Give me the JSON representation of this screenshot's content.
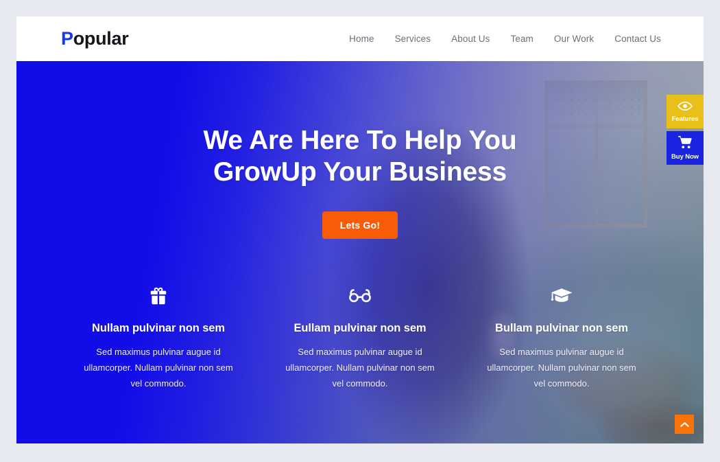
{
  "brand": {
    "accent_letter": "P",
    "rest": "opular",
    "accent_color": "#1439e8"
  },
  "nav": {
    "items": [
      {
        "label": "Home"
      },
      {
        "label": "Services"
      },
      {
        "label": "About Us"
      },
      {
        "label": "Team"
      },
      {
        "label": "Our Work"
      },
      {
        "label": "Contact Us"
      }
    ]
  },
  "hero": {
    "title_line1": "We Are Here To Help You",
    "title_line2": "GrowUp Your Business",
    "cta_label": "Lets Go!",
    "cta_color": "#f95c06",
    "overlay_color": "#120ce8"
  },
  "features": [
    {
      "icon": "gift-icon",
      "title": "Nullam pulvinar non sem",
      "text": "Sed maximus pulvinar augue id ullamcorper. Nullam pulvinar non sem vel commodo."
    },
    {
      "icon": "glasses-icon",
      "title": "Eullam pulvinar non sem",
      "text": "Sed maximus pulvinar augue id ullamcorper. Nullam pulvinar non sem vel commodo."
    },
    {
      "icon": "graduation-cap-icon",
      "title": "Bullam pulvinar non sem",
      "text": "Sed maximus pulvinar augue id ullamcorper. Nullam pulvinar non sem vel commodo."
    }
  ],
  "side_actions": [
    {
      "label": "Features",
      "icon": "eye-icon",
      "color": "#e9bf1a"
    },
    {
      "label": "Buy Now",
      "icon": "shopping-cart-icon",
      "color": "#1a24e0"
    }
  ],
  "scroll_top": {
    "icon": "chevron-up-icon",
    "color": "#f97306"
  }
}
